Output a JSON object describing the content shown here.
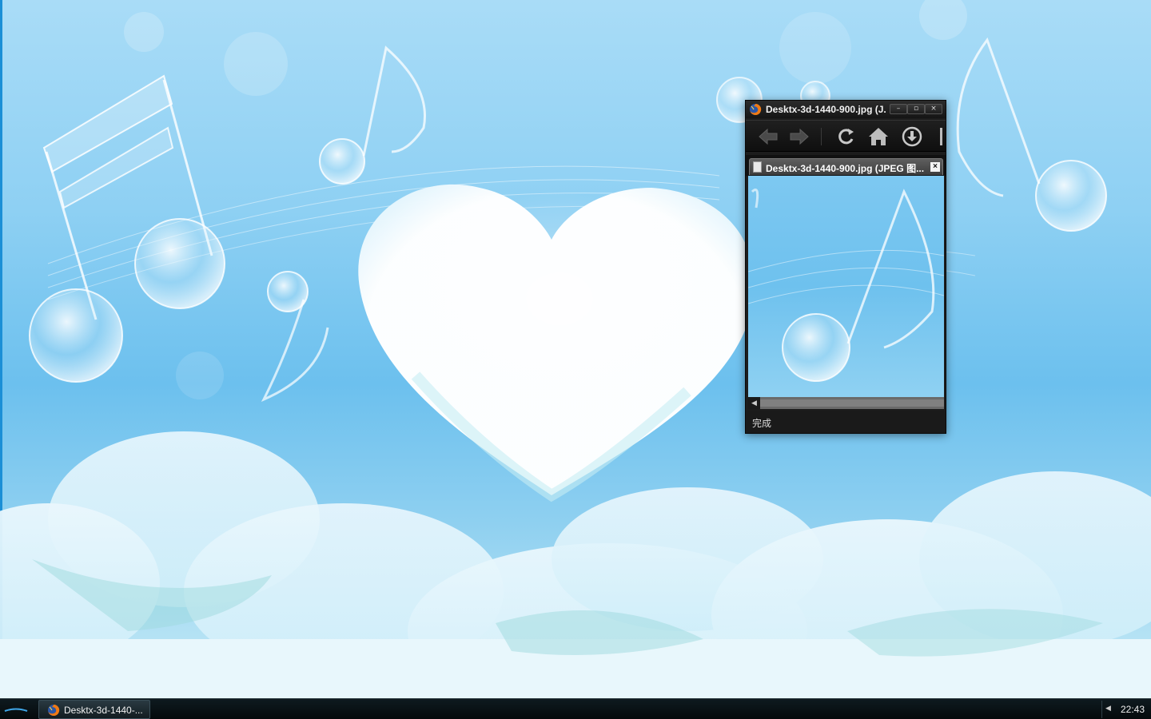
{
  "browser": {
    "title": "Desktx-3d-1440-900.jpg (J...",
    "tab_label": "Desktx-3d-1440-900.jpg (JPEG 图...",
    "status": "完成",
    "minimize_glyph": "–",
    "maximize_glyph": "▫",
    "close_glyph": "×",
    "tab_close_glyph": "×",
    "scroll_left_glyph": "◀"
  },
  "taskbar": {
    "item_label": "Desktx-3d-1440-...",
    "tray_arrow": "◀",
    "clock": "22:43"
  },
  "icons": {
    "app": "firefox-icon",
    "nav": [
      "back-arrow-icon",
      "forward-arrow-icon",
      "reload-icon",
      "home-icon",
      "download-icon"
    ],
    "doc": "document-icon"
  },
  "colors": {
    "sky": "#8fcdf0",
    "window_chrome": "#1c1c1c",
    "taskbar": "#0a1418",
    "desktop_edge": "#1b8fd6"
  }
}
